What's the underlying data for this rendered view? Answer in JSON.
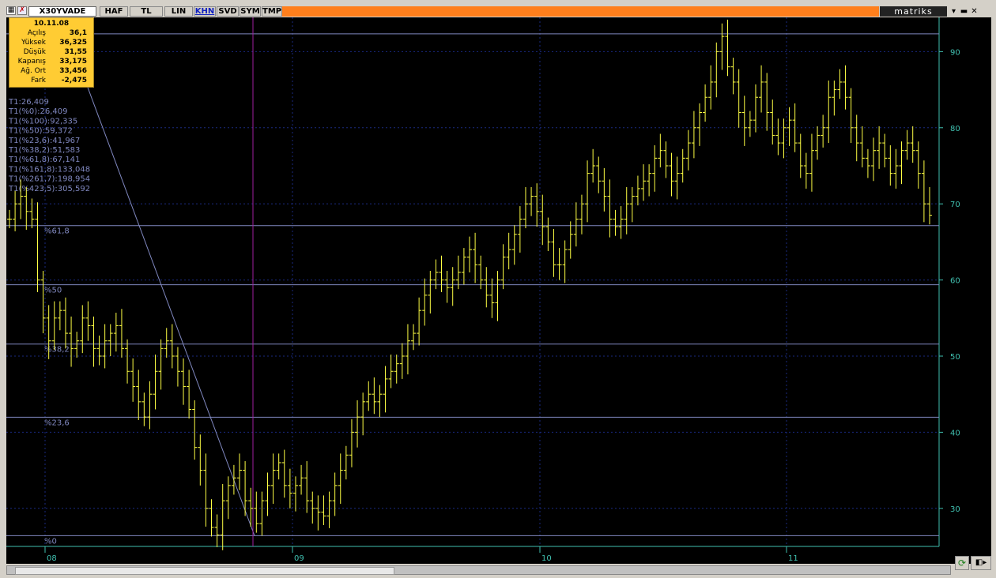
{
  "toolbar": {
    "symbol": "X30YVADE",
    "buttons": [
      "HAF",
      "TL",
      "LIN",
      "KHN",
      "SVD",
      "SYM",
      "TMP"
    ],
    "active_button": "KHN",
    "brand": "matriks"
  },
  "info": {
    "date": "10.11.08",
    "rows": [
      {
        "label": "Açılış",
        "value": "36,1"
      },
      {
        "label": "Yüksek",
        "value": "36,325"
      },
      {
        "label": "Düşük",
        "value": "31,55"
      },
      {
        "label": "Kapanış",
        "value": "33,175"
      },
      {
        "label": "Ağ. Ort",
        "value": "33,456"
      },
      {
        "label": "Fark",
        "value": "-2,475"
      }
    ]
  },
  "fib_text": [
    "T1:26,409",
    "T1(%0):26,409",
    "T1(%100):92,335",
    "T1(%50):59,372",
    "T1(%23,6):41,967",
    "T1(%38,2):51,583",
    "T1(%61,8):67,141",
    "T1(%161,8):133,048",
    "T1(%261,7):198,954",
    "T1(%423,5):305,592"
  ],
  "colors": {
    "background": "#000000",
    "bars": "#ffff44",
    "fib_lines": "#8088c0",
    "axis": "#40c0b0",
    "cursor": "#a020a0"
  },
  "chart_data": {
    "type": "ohlc-bar",
    "ylim": [
      25,
      94.5
    ],
    "yticks": [
      30,
      40,
      50,
      60,
      70,
      80,
      90
    ],
    "xticks": [
      "08",
      "09",
      "10",
      "11"
    ],
    "fib_levels": [
      {
        "label": "%61,8",
        "value": 67.141
      },
      {
        "label": "%50",
        "value": 59.372
      },
      {
        "label": "%38,2",
        "value": 51.583
      },
      {
        "label": "%23,6",
        "value": 41.967
      },
      {
        "label": "%0",
        "value": 26.409
      },
      {
        "label": "%100",
        "value": 92.335
      }
    ],
    "series_close": [
      68,
      70,
      71,
      69,
      68,
      60,
      55,
      52,
      55,
      56,
      53,
      51,
      52,
      55,
      54,
      51,
      50,
      52,
      53,
      54,
      51,
      48,
      46,
      44,
      42,
      45,
      48,
      51,
      52,
      50,
      48,
      46,
      43,
      38,
      35,
      30,
      27.5,
      26.5,
      31,
      33,
      34,
      35,
      31,
      30,
      28,
      31,
      33,
      35,
      36,
      33,
      32,
      33,
      34,
      31,
      30,
      29.5,
      29,
      31,
      33,
      35,
      37,
      40,
      42,
      44,
      45,
      44,
      45,
      47,
      48,
      49,
      50,
      52,
      53,
      56,
      58,
      60,
      61,
      60,
      59,
      60,
      61,
      63,
      64,
      62,
      60,
      58,
      57,
      60,
      63,
      64,
      66,
      68,
      70,
      71,
      69,
      67,
      65,
      62,
      62,
      64,
      66,
      68,
      70,
      74,
      75,
      73,
      71,
      68,
      67,
      68,
      70,
      71,
      72,
      73,
      74,
      76,
      77,
      75,
      73,
      74,
      76,
      78,
      80,
      82,
      84,
      86,
      90,
      92,
      88,
      86,
      82,
      80,
      81,
      84,
      86,
      82,
      79,
      78,
      80,
      81,
      78,
      75,
      74,
      77,
      79,
      80,
      84,
      85,
      86,
      84,
      80,
      78,
      76,
      75,
      77,
      78,
      76,
      74,
      75,
      77,
      78,
      77,
      74,
      70,
      68.5
    ]
  }
}
